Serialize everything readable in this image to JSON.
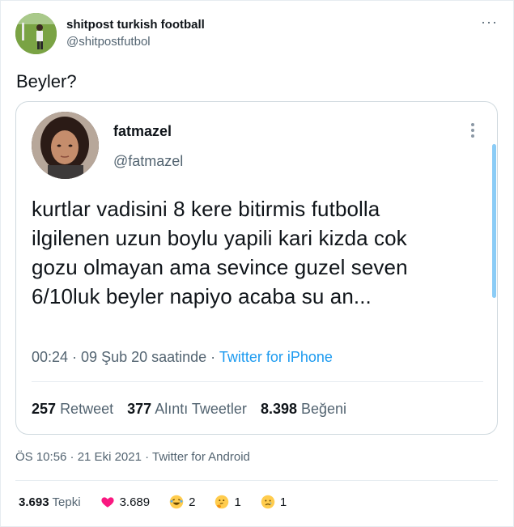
{
  "author": {
    "name": "shitpost turkish football",
    "handle": "@shitpostfutbol"
  },
  "tweet": {
    "text": "Beyler?"
  },
  "quoted": {
    "name": "fatmazel",
    "handle": "@fatmazel",
    "lines": [
      "kurtlar vadisini 8 kere bitirmis futbolla",
      "ilgilenen uzun boylu yapili kari kizda cok",
      "gozu olmayan ama sevince guzel seven",
      "6/10luk beyler napiyo acaba su an..."
    ],
    "time": "00:24 · 09 Şub 20 saatinde · ",
    "source": "Twitter for iPhone",
    "stats": {
      "retweets_count": "257",
      "retweets_label": "Retweet",
      "quotes_count": "377",
      "quotes_label": "Alıntı Tweetler",
      "likes_count": "8.398",
      "likes_label": "Beğeni"
    }
  },
  "meta": {
    "text": "ÖS 10:56 · 21 Eki 2021 · Twitter for Android"
  },
  "reactions": {
    "total_count": "3.693",
    "total_label": "Tepki",
    "items": [
      {
        "icon": "heart-icon",
        "count": "3.689"
      },
      {
        "icon": "laughing-emoji-icon",
        "count": "2"
      },
      {
        "icon": "thinking-emoji-icon",
        "count": "1"
      },
      {
        "icon": "sad-emoji-icon",
        "count": "1"
      }
    ]
  },
  "colors": {
    "accent": "#1d9bf0",
    "heart": "#f91880",
    "muted": "#536471",
    "border": "#cfd9de"
  }
}
